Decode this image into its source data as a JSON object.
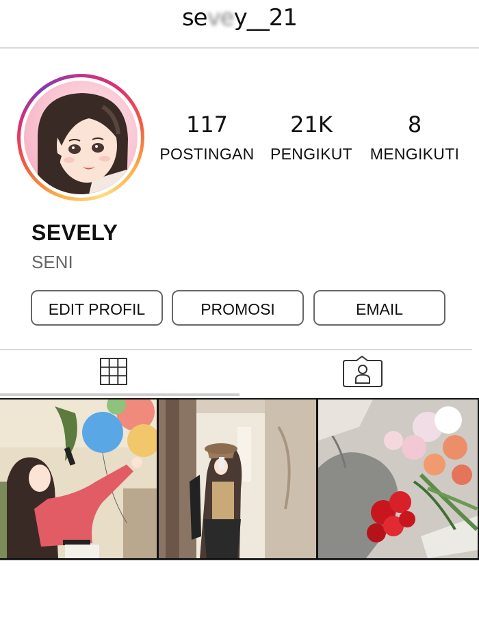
{
  "profile": {
    "username": "se▒▒y__21",
    "display_name": "SEVELY",
    "category": "SENI"
  },
  "stats": {
    "posts_count": "117",
    "posts_label": "POSTINGAN",
    "followers_count": "21K",
    "followers_label": "PENGIKUT",
    "following_count": "8",
    "following_label": "MENGIKUTI"
  },
  "actions": {
    "edit_profile": "EDIT PROFIL",
    "promote": "PROMOSI",
    "email": "EMAIL"
  },
  "tabs": [
    {
      "icon": "grid-icon",
      "active": true
    },
    {
      "icon": "tagged-person-icon",
      "active": false
    }
  ],
  "posts": [
    {
      "subject": "girl with phone and balloons"
    },
    {
      "subject": "girl in hat taking mirror selfie"
    },
    {
      "subject": "bouquet of flowers"
    }
  ],
  "colors": {
    "story_ring": [
      "#c13584",
      "#e1306c",
      "#fcaf45"
    ],
    "text": "#111111",
    "secondary_text": "#666666",
    "divider": "#d9d9d9"
  }
}
